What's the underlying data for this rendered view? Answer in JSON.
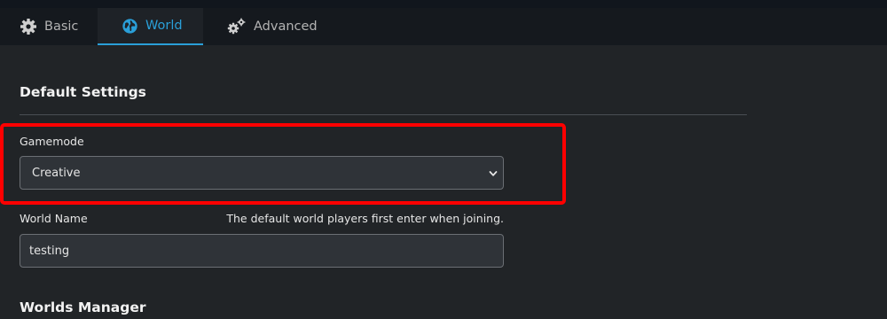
{
  "tabs": [
    {
      "label": "Basic",
      "icon": "gear-icon",
      "active": false
    },
    {
      "label": "World",
      "icon": "globe-icon",
      "active": true
    },
    {
      "label": "Advanced",
      "icon": "gears-icon",
      "active": false
    }
  ],
  "default_settings": {
    "title": "Default Settings",
    "gamemode": {
      "label": "Gamemode",
      "selected": "Creative"
    },
    "world_name": {
      "label": "World Name",
      "help": "The default world players first enter when joining.",
      "value": "testing"
    }
  },
  "worlds_manager": {
    "title": "Worlds Manager"
  },
  "colors": {
    "accent": "#2a9fd8",
    "highlight": "#ff0000",
    "background": "#212427"
  }
}
